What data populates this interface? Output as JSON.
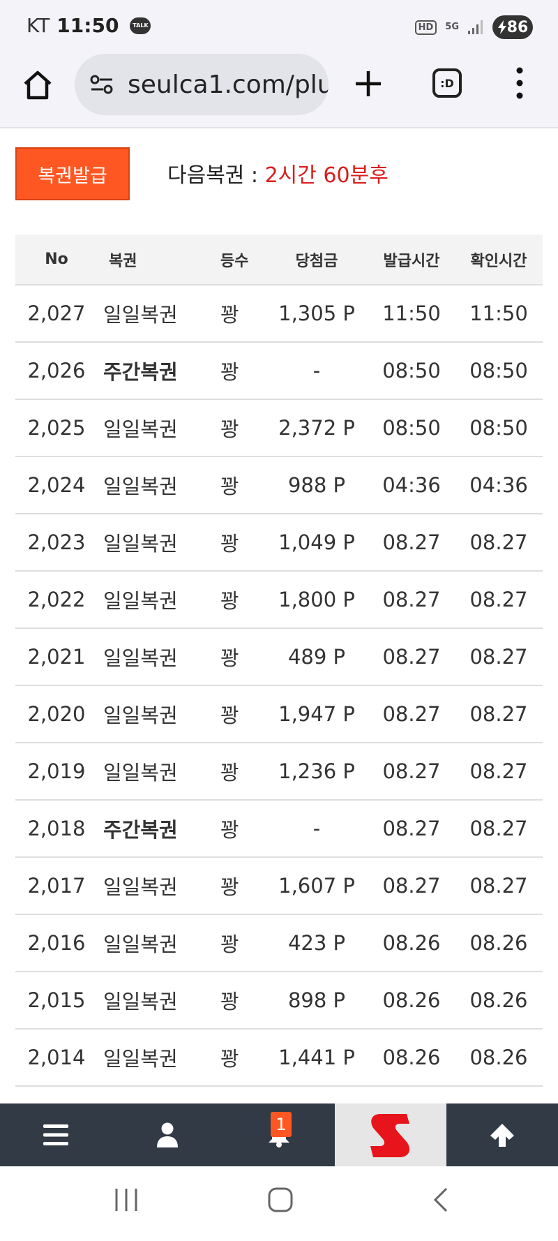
{
  "status_bar": {
    "carrier": "KT",
    "time": "11:50",
    "talk_label": "TALK",
    "hd_label": "HD",
    "network": "5G",
    "battery": "86"
  },
  "browser": {
    "url": "seulca1.com/plu",
    "tabs_label": ":D"
  },
  "header": {
    "issue_button_label": "복권발급",
    "next_ticket_label": "다음복권 : ",
    "next_ticket_countdown": "2시간 60분후",
    "countdown_color": "#d91d1d",
    "accent_color": "#ff5722"
  },
  "table": {
    "columns": [
      "No",
      "복권",
      "등수",
      "당첨금",
      "발급시간",
      "확인시간"
    ],
    "rows": [
      {
        "no": "2,027",
        "type": "일일복권",
        "rank": "꽝",
        "prize": "1,305 P",
        "issued": "11:50",
        "confirmed": "11:50",
        "bold": false
      },
      {
        "no": "2,026",
        "type": "주간복권",
        "rank": "꽝",
        "prize": "-",
        "issued": "08:50",
        "confirmed": "08:50",
        "bold": true
      },
      {
        "no": "2,025",
        "type": "일일복권",
        "rank": "꽝",
        "prize": "2,372 P",
        "issued": "08:50",
        "confirmed": "08:50",
        "bold": false
      },
      {
        "no": "2,024",
        "type": "일일복권",
        "rank": "꽝",
        "prize": "988 P",
        "issued": "04:36",
        "confirmed": "04:36",
        "bold": false
      },
      {
        "no": "2,023",
        "type": "일일복권",
        "rank": "꽝",
        "prize": "1,049 P",
        "issued": "08.27",
        "confirmed": "08.27",
        "bold": false
      },
      {
        "no": "2,022",
        "type": "일일복권",
        "rank": "꽝",
        "prize": "1,800 P",
        "issued": "08.27",
        "confirmed": "08.27",
        "bold": false
      },
      {
        "no": "2,021",
        "type": "일일복권",
        "rank": "꽝",
        "prize": "489 P",
        "issued": "08.27",
        "confirmed": "08.27",
        "bold": false
      },
      {
        "no": "2,020",
        "type": "일일복권",
        "rank": "꽝",
        "prize": "1,947 P",
        "issued": "08.27",
        "confirmed": "08.27",
        "bold": false
      },
      {
        "no": "2,019",
        "type": "일일복권",
        "rank": "꽝",
        "prize": "1,236 P",
        "issued": "08.27",
        "confirmed": "08.27",
        "bold": false
      },
      {
        "no": "2,018",
        "type": "주간복권",
        "rank": "꽝",
        "prize": "-",
        "issued": "08.27",
        "confirmed": "08.27",
        "bold": true
      },
      {
        "no": "2,017",
        "type": "일일복권",
        "rank": "꽝",
        "prize": "1,607 P",
        "issued": "08.27",
        "confirmed": "08.27",
        "bold": false
      },
      {
        "no": "2,016",
        "type": "일일복권",
        "rank": "꽝",
        "prize": "423 P",
        "issued": "08.26",
        "confirmed": "08.26",
        "bold": false
      },
      {
        "no": "2,015",
        "type": "일일복권",
        "rank": "꽝",
        "prize": "898 P",
        "issued": "08.26",
        "confirmed": "08.26",
        "bold": false
      },
      {
        "no": "2,014",
        "type": "일일복권",
        "rank": "꽝",
        "prize": "1,441 P",
        "issued": "08.26",
        "confirmed": "08.26",
        "bold": false
      }
    ]
  },
  "bottom_nav": {
    "items": [
      "menu-icon",
      "user-icon",
      "bell-icon",
      "site-logo",
      "arrow-up-icon"
    ],
    "notification_count": "1",
    "logo_letter": "S",
    "logo_color": "#e8141b"
  },
  "android_nav": {
    "items": [
      "recents-icon",
      "home-icon",
      "back-icon"
    ]
  }
}
